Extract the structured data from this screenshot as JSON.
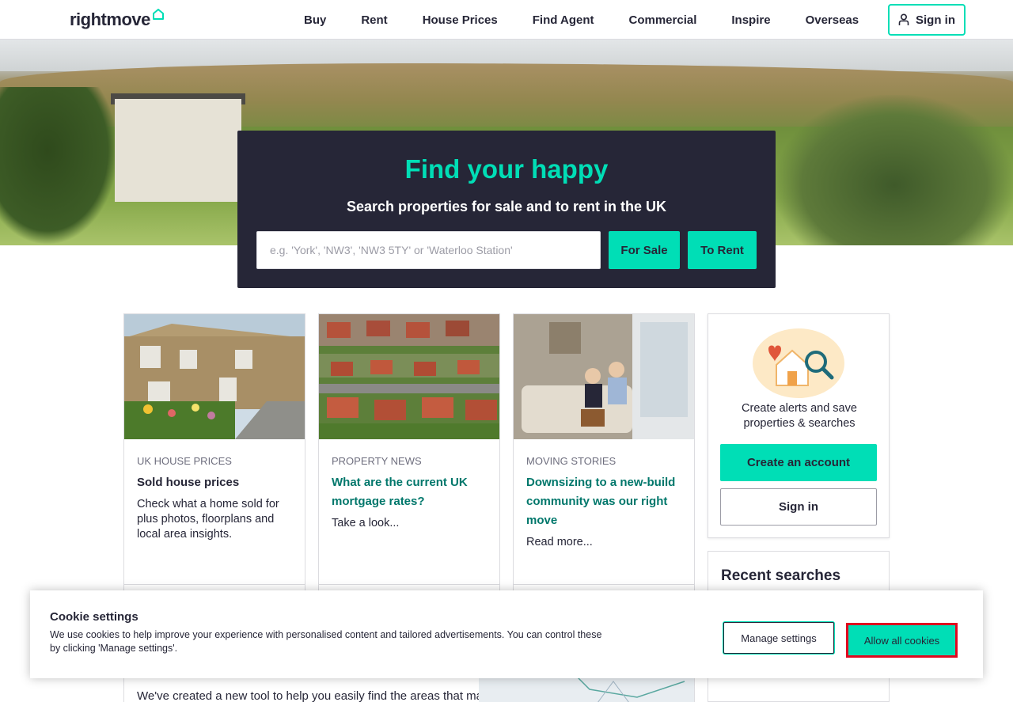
{
  "header": {
    "logo": "rightmove",
    "nav": [
      "Buy",
      "Rent",
      "House Prices",
      "Find Agent",
      "Commercial",
      "Inspire",
      "Overseas"
    ],
    "signin_label": "Sign in"
  },
  "hero": {
    "headline": "Find your happy",
    "subheadline": "Search properties for sale and to rent in the UK",
    "search_placeholder": "e.g. 'York', 'NW3', 'NW3 5TY' or 'Waterloo Station'",
    "search_value": "",
    "for_sale_label": "For Sale",
    "to_rent_label": "To Rent"
  },
  "cards": [
    {
      "category": "UK HOUSE PRICES",
      "title": "Sold house prices",
      "text": "Check what a home sold for plus photos, floorplans and local area insights."
    },
    {
      "category": "PROPERTY NEWS",
      "title": "What are the current UK mortgage rates?",
      "text": "Take a look..."
    },
    {
      "category": "MOVING STORIES",
      "title": "Downsizing to a new-build community was our right move",
      "text": "Read more..."
    }
  ],
  "sidebar": {
    "alerts_text": "Create alerts and save properties & searches",
    "create_account_label": "Create an account",
    "signin_label": "Sign in",
    "recent_searches_title": "Recent searches"
  },
  "bottom_card": {
    "text": "We've created a new tool to help you easily find the areas that match your"
  },
  "cookie": {
    "title": "Cookie settings",
    "text": "We use cookies to help improve your experience with personalised content and tailored advertisements. You can control these by clicking 'Manage settings'.",
    "manage_label": "Manage settings",
    "allow_label": "Allow all cookies"
  },
  "colors": {
    "accent": "#00deb6",
    "dark": "#262637",
    "link_teal": "#00776b",
    "highlight": "#e0081f"
  }
}
